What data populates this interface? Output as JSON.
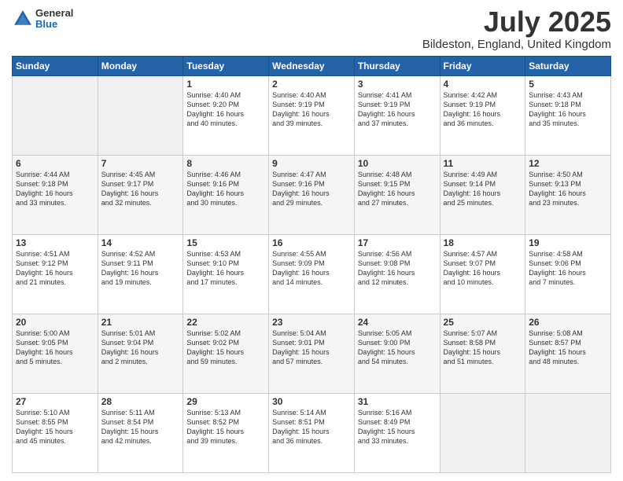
{
  "logo": {
    "general": "General",
    "blue": "Blue"
  },
  "header": {
    "month": "July 2025",
    "location": "Bildeston, England, United Kingdom"
  },
  "weekdays": [
    "Sunday",
    "Monday",
    "Tuesday",
    "Wednesday",
    "Thursday",
    "Friday",
    "Saturday"
  ],
  "weeks": [
    [
      {
        "day": "",
        "info": ""
      },
      {
        "day": "",
        "info": ""
      },
      {
        "day": "1",
        "info": "Sunrise: 4:40 AM\nSunset: 9:20 PM\nDaylight: 16 hours\nand 40 minutes."
      },
      {
        "day": "2",
        "info": "Sunrise: 4:40 AM\nSunset: 9:19 PM\nDaylight: 16 hours\nand 39 minutes."
      },
      {
        "day": "3",
        "info": "Sunrise: 4:41 AM\nSunset: 9:19 PM\nDaylight: 16 hours\nand 37 minutes."
      },
      {
        "day": "4",
        "info": "Sunrise: 4:42 AM\nSunset: 9:19 PM\nDaylight: 16 hours\nand 36 minutes."
      },
      {
        "day": "5",
        "info": "Sunrise: 4:43 AM\nSunset: 9:18 PM\nDaylight: 16 hours\nand 35 minutes."
      }
    ],
    [
      {
        "day": "6",
        "info": "Sunrise: 4:44 AM\nSunset: 9:18 PM\nDaylight: 16 hours\nand 33 minutes."
      },
      {
        "day": "7",
        "info": "Sunrise: 4:45 AM\nSunset: 9:17 PM\nDaylight: 16 hours\nand 32 minutes."
      },
      {
        "day": "8",
        "info": "Sunrise: 4:46 AM\nSunset: 9:16 PM\nDaylight: 16 hours\nand 30 minutes."
      },
      {
        "day": "9",
        "info": "Sunrise: 4:47 AM\nSunset: 9:16 PM\nDaylight: 16 hours\nand 29 minutes."
      },
      {
        "day": "10",
        "info": "Sunrise: 4:48 AM\nSunset: 9:15 PM\nDaylight: 16 hours\nand 27 minutes."
      },
      {
        "day": "11",
        "info": "Sunrise: 4:49 AM\nSunset: 9:14 PM\nDaylight: 16 hours\nand 25 minutes."
      },
      {
        "day": "12",
        "info": "Sunrise: 4:50 AM\nSunset: 9:13 PM\nDaylight: 16 hours\nand 23 minutes."
      }
    ],
    [
      {
        "day": "13",
        "info": "Sunrise: 4:51 AM\nSunset: 9:12 PM\nDaylight: 16 hours\nand 21 minutes."
      },
      {
        "day": "14",
        "info": "Sunrise: 4:52 AM\nSunset: 9:11 PM\nDaylight: 16 hours\nand 19 minutes."
      },
      {
        "day": "15",
        "info": "Sunrise: 4:53 AM\nSunset: 9:10 PM\nDaylight: 16 hours\nand 17 minutes."
      },
      {
        "day": "16",
        "info": "Sunrise: 4:55 AM\nSunset: 9:09 PM\nDaylight: 16 hours\nand 14 minutes."
      },
      {
        "day": "17",
        "info": "Sunrise: 4:56 AM\nSunset: 9:08 PM\nDaylight: 16 hours\nand 12 minutes."
      },
      {
        "day": "18",
        "info": "Sunrise: 4:57 AM\nSunset: 9:07 PM\nDaylight: 16 hours\nand 10 minutes."
      },
      {
        "day": "19",
        "info": "Sunrise: 4:58 AM\nSunset: 9:06 PM\nDaylight: 16 hours\nand 7 minutes."
      }
    ],
    [
      {
        "day": "20",
        "info": "Sunrise: 5:00 AM\nSunset: 9:05 PM\nDaylight: 16 hours\nand 5 minutes."
      },
      {
        "day": "21",
        "info": "Sunrise: 5:01 AM\nSunset: 9:04 PM\nDaylight: 16 hours\nand 2 minutes."
      },
      {
        "day": "22",
        "info": "Sunrise: 5:02 AM\nSunset: 9:02 PM\nDaylight: 15 hours\nand 59 minutes."
      },
      {
        "day": "23",
        "info": "Sunrise: 5:04 AM\nSunset: 9:01 PM\nDaylight: 15 hours\nand 57 minutes."
      },
      {
        "day": "24",
        "info": "Sunrise: 5:05 AM\nSunset: 9:00 PM\nDaylight: 15 hours\nand 54 minutes."
      },
      {
        "day": "25",
        "info": "Sunrise: 5:07 AM\nSunset: 8:58 PM\nDaylight: 15 hours\nand 51 minutes."
      },
      {
        "day": "26",
        "info": "Sunrise: 5:08 AM\nSunset: 8:57 PM\nDaylight: 15 hours\nand 48 minutes."
      }
    ],
    [
      {
        "day": "27",
        "info": "Sunrise: 5:10 AM\nSunset: 8:55 PM\nDaylight: 15 hours\nand 45 minutes."
      },
      {
        "day": "28",
        "info": "Sunrise: 5:11 AM\nSunset: 8:54 PM\nDaylight: 15 hours\nand 42 minutes."
      },
      {
        "day": "29",
        "info": "Sunrise: 5:13 AM\nSunset: 8:52 PM\nDaylight: 15 hours\nand 39 minutes."
      },
      {
        "day": "30",
        "info": "Sunrise: 5:14 AM\nSunset: 8:51 PM\nDaylight: 15 hours\nand 36 minutes."
      },
      {
        "day": "31",
        "info": "Sunrise: 5:16 AM\nSunset: 8:49 PM\nDaylight: 15 hours\nand 33 minutes."
      },
      {
        "day": "",
        "info": ""
      },
      {
        "day": "",
        "info": ""
      }
    ]
  ]
}
